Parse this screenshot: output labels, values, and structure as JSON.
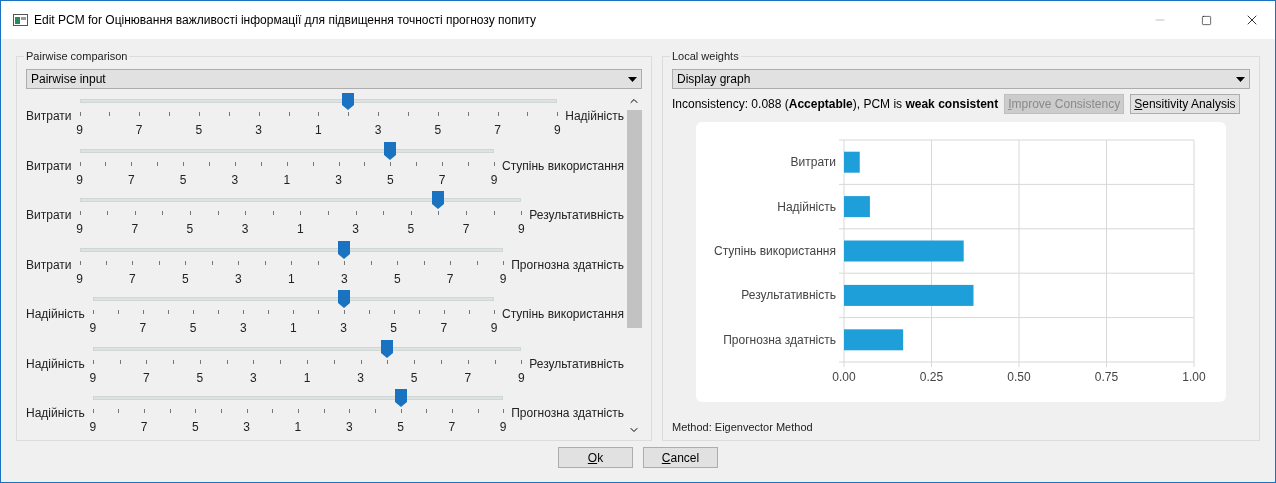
{
  "window": {
    "title": "Edit PCM for Оцінювання важливості інформації для підвищення точності прогнозу попиту"
  },
  "pairwise": {
    "title": "Pairwise comparison",
    "mode": "Pairwise input",
    "rows": [
      {
        "left": "Витрати",
        "right": "Надійність",
        "level": 0.5625,
        "scale": [
          "9",
          "7",
          "5",
          "3",
          "1",
          "3",
          "5",
          "7",
          "9"
        ]
      },
      {
        "left": "Витрати",
        "right": "Ступінь використання",
        "level": 0.75,
        "scale": [
          "9",
          "7",
          "5",
          "3",
          "1",
          "3",
          "5",
          "7",
          "9"
        ]
      },
      {
        "left": "Витрати",
        "right": "Результативність",
        "level": 0.8125,
        "scale": [
          "9",
          "7",
          "5",
          "3",
          "1",
          "3",
          "5",
          "7",
          "9"
        ]
      },
      {
        "left": "Витрати",
        "right": "Прогнозна здатність",
        "level": 0.625,
        "scale": [
          "9",
          "7",
          "5",
          "3",
          "1",
          "3",
          "5",
          "7",
          "9"
        ]
      },
      {
        "left": "Надійність",
        "right": "Ступінь використання",
        "level": 0.625,
        "scale": [
          "9",
          "7",
          "5",
          "3",
          "1",
          "3",
          "5",
          "7",
          "9"
        ]
      },
      {
        "left": "Надійність",
        "right": "Результативність",
        "level": 0.6875,
        "scale": [
          "9",
          "7",
          "5",
          "3",
          "1",
          "3",
          "5",
          "7",
          "9"
        ]
      },
      {
        "left": "Надійність",
        "right": "Прогнозна здатність",
        "level": 0.75,
        "scale": [
          "9",
          "7",
          "5",
          "3",
          "1",
          "3",
          "5",
          "7",
          "9"
        ]
      }
    ]
  },
  "weights": {
    "title": "Local weights",
    "display": "Display graph",
    "inconsistency": "Inconsistency: 0.088 (**Acceptable**), PCM is **weak consistent**",
    "buttons": [
      {
        "label": "Improve Consistency",
        "disabled": true
      },
      {
        "label": "Sensitivity Analysis",
        "disabled": false
      }
    ],
    "chart_data": {
      "type": "bar",
      "orientation": "horizontal",
      "categories": [
        "Витрати",
        "Надійність",
        "Ступінь використання",
        "Результативність",
        "Прогнозна здатність"
      ],
      "grid": true,
      "series": [
        {
          "color": "#1e9fda",
          "values": [
            0.045,
            0.074,
            0.342,
            0.37,
            0.169
          ]
        }
      ],
      "xlim": [
        0,
        1
      ],
      "xticks": [
        {
          "value": 0,
          "label": "0.00"
        },
        {
          "value": 0.25,
          "label": "0.25"
        },
        {
          "value": 0.5,
          "label": "0.50"
        },
        {
          "value": 0.75,
          "label": "0.75"
        },
        {
          "value": 1,
          "label": "1.00"
        }
      ]
    },
    "method": "Method: Eigenvector Method"
  },
  "buttons": [
    {
      "label": "Ok"
    },
    {
      "label": "Cancel"
    }
  ]
}
